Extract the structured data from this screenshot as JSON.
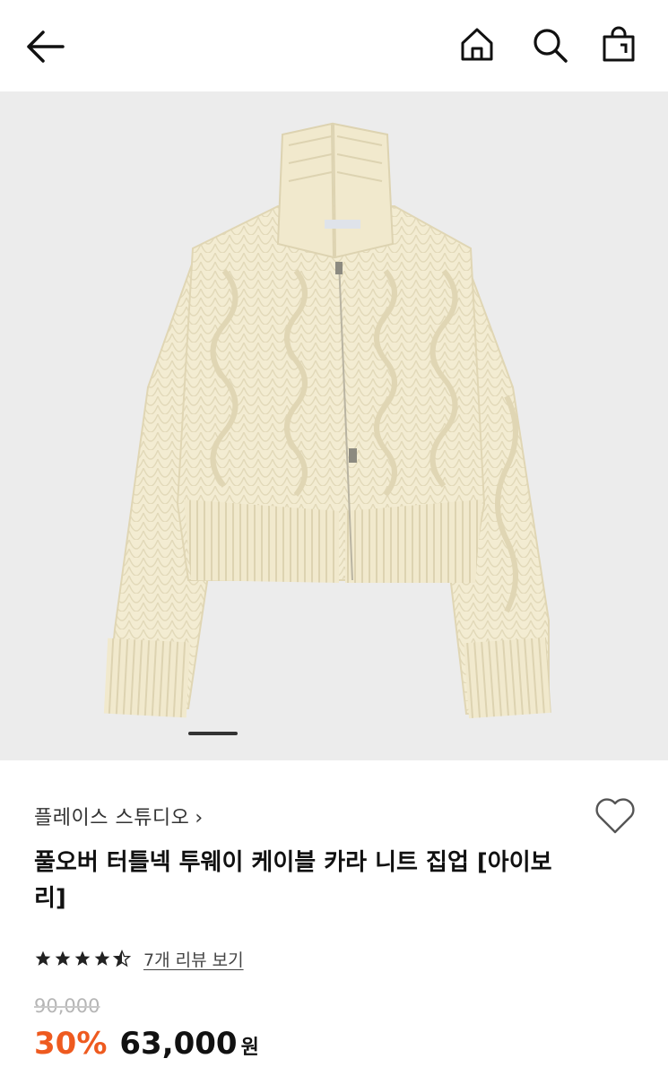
{
  "header": {
    "back_icon": "arrow-left-icon",
    "home_icon": "home-icon",
    "search_icon": "search-icon",
    "bag_icon": "shopping-bag-icon"
  },
  "gallery": {
    "current_index": 1,
    "image_subject": "cream cable-knit two-way zip-up knit sweater"
  },
  "product": {
    "brand": "플레이스 스튜디오",
    "brand_chevron": "›",
    "title": "풀오버 터틀넥 투웨이 케이블 카라 니트 집업 [아이보리]",
    "rating": 4.5,
    "review_link": "7개 리뷰 보기",
    "original_price": "90,000",
    "discount": "30%",
    "price": "63,000",
    "currency": "원"
  },
  "colors": {
    "accent": "#ee5a1f",
    "image_bg": "#ececec",
    "knit": "#f3ecd2"
  }
}
